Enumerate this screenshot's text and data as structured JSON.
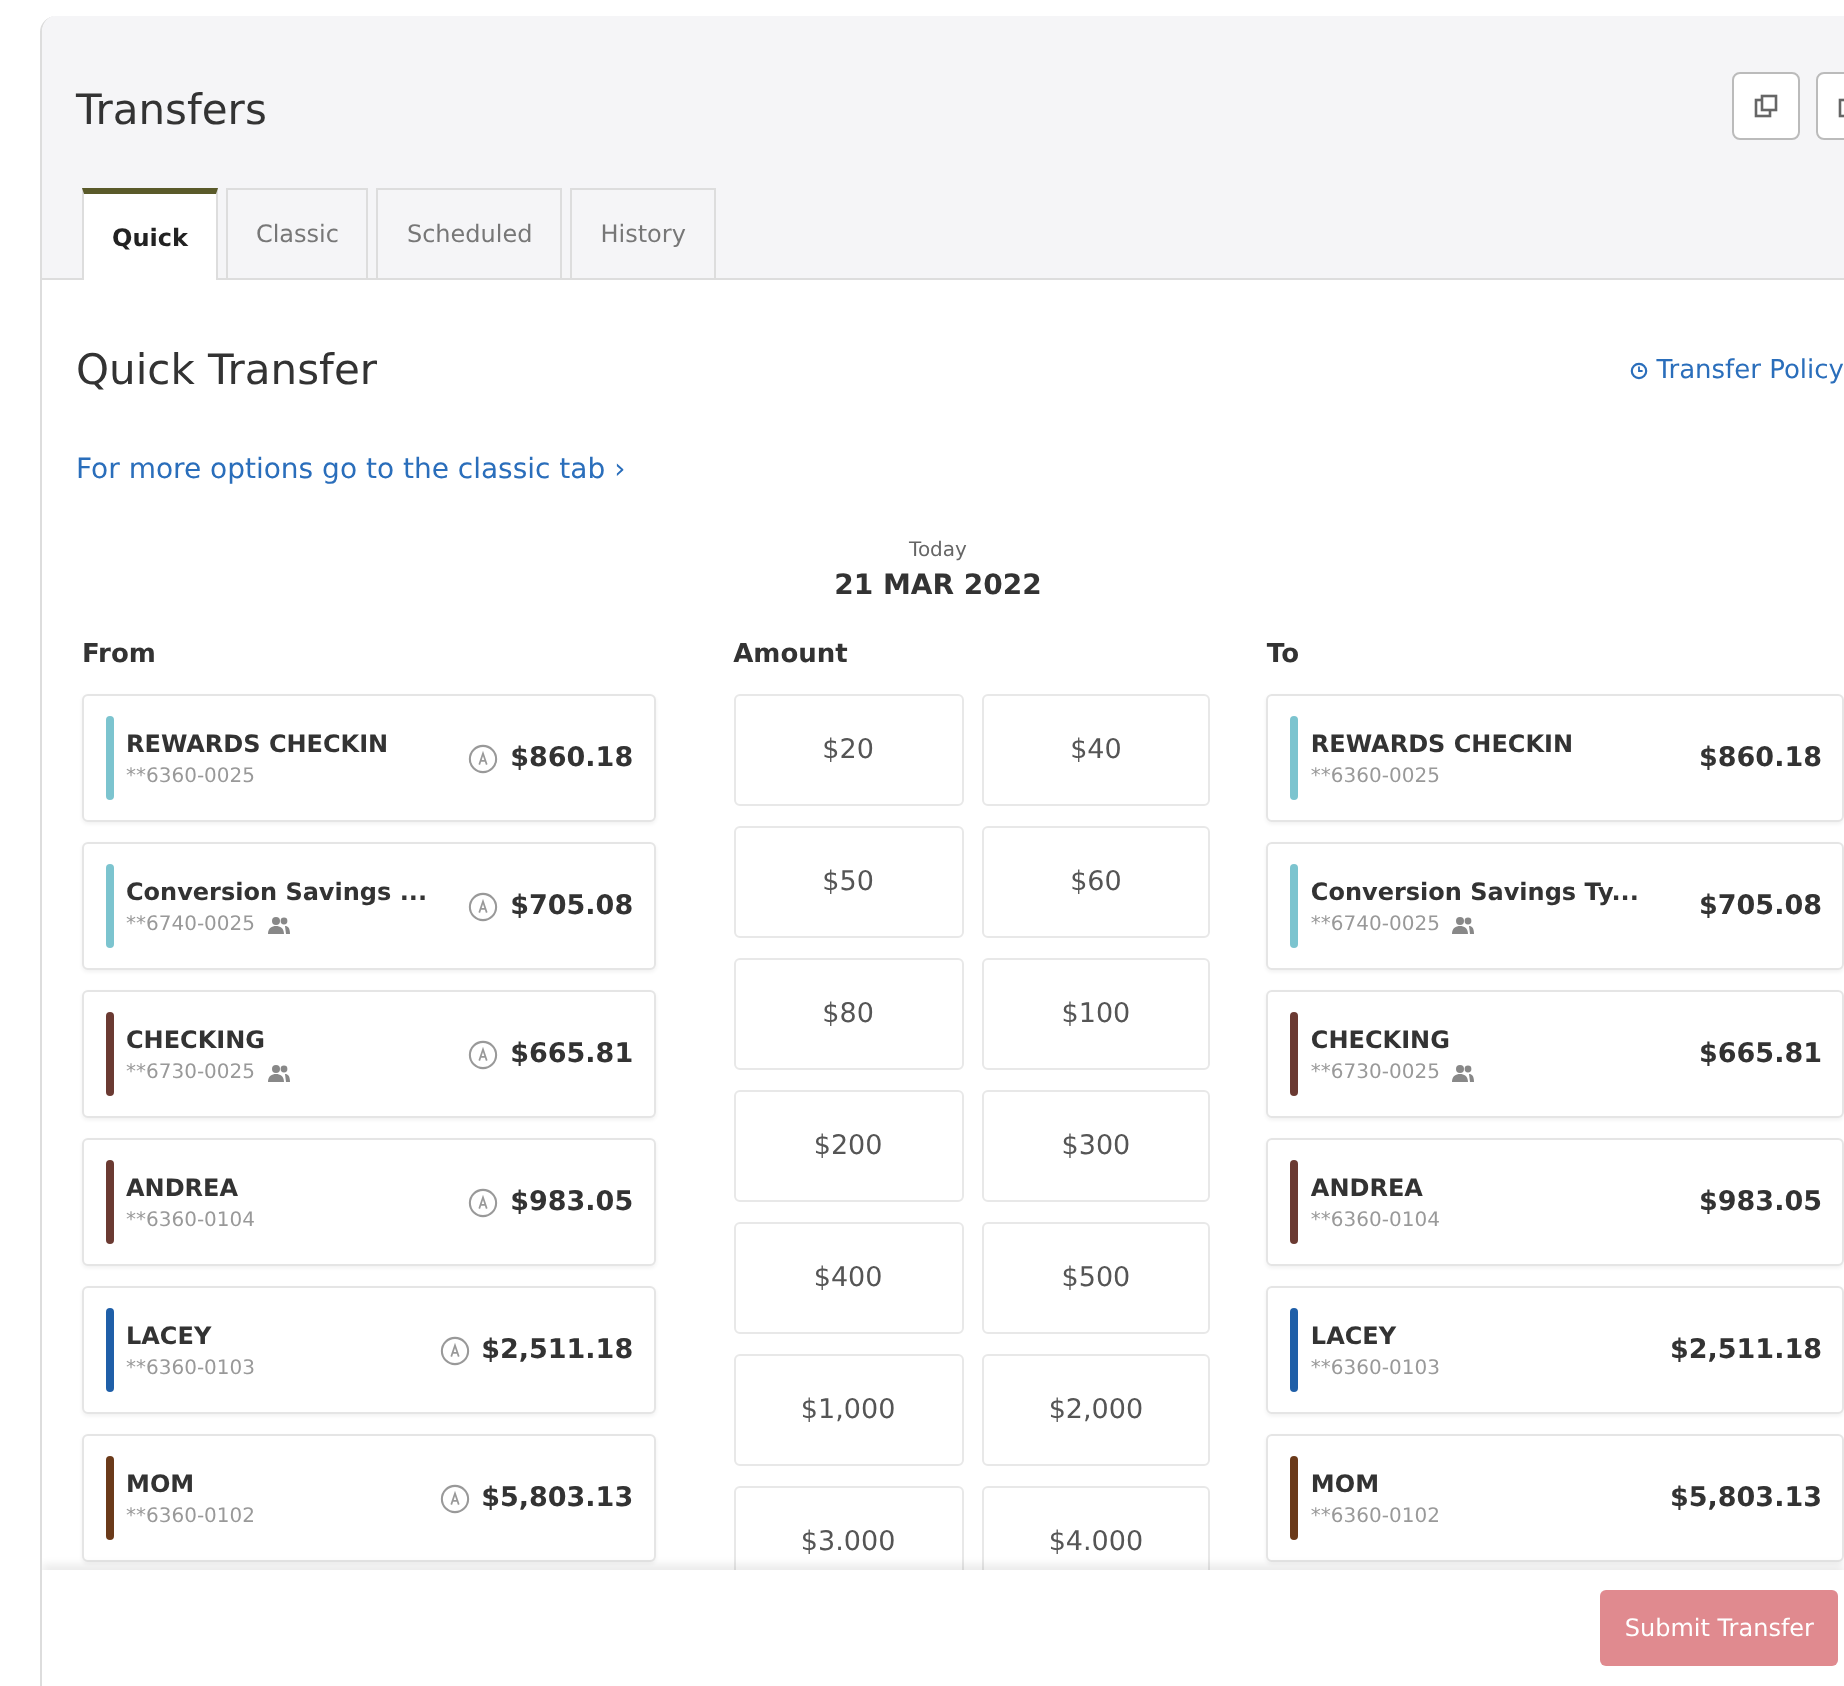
{
  "title": "Transfers",
  "tabs": [
    {
      "label": "Quick",
      "selected": true
    },
    {
      "label": "Classic",
      "selected": false
    },
    {
      "label": "Scheduled",
      "selected": false
    },
    {
      "label": "History",
      "selected": false
    }
  ],
  "section": {
    "title": "Quick Transfer",
    "policy_link": "Transfer Policy",
    "classic_link": "For more options go to the classic tab ›"
  },
  "date": {
    "label": "Today",
    "value": "21 MAR 2022"
  },
  "from": {
    "heading": "From",
    "accounts": [
      {
        "name": "REWARDS CHECKIN",
        "number": "**6360-0025",
        "shared": false,
        "color": "#7cc4cf",
        "balance": "$860.18"
      },
      {
        "name": "Conversion Savings ...",
        "number": "**6740-0025",
        "shared": true,
        "color": "#7cc4cf",
        "balance": "$705.08"
      },
      {
        "name": "CHECKING",
        "number": "**6730-0025",
        "shared": true,
        "color": "#6b3a32",
        "balance": "$665.81"
      },
      {
        "name": "ANDREA",
        "number": "**6360-0104",
        "shared": false,
        "color": "#6b3a32",
        "balance": "$983.05"
      },
      {
        "name": "LACEY",
        "number": "**6360-0103",
        "shared": false,
        "color": "#1f5fa8",
        "balance": "$2,511.18"
      },
      {
        "name": "MOM",
        "number": "**6360-0102",
        "shared": false,
        "color": "#6b3a1a",
        "balance": "$5,803.13"
      }
    ]
  },
  "amount": {
    "heading": "Amount",
    "options": [
      "$20",
      "$40",
      "$50",
      "$60",
      "$80",
      "$100",
      "$200",
      "$300",
      "$400",
      "$500",
      "$1,000",
      "$2,000",
      "$3.000",
      "$4.000"
    ]
  },
  "to": {
    "heading": "To",
    "accounts": [
      {
        "name": "REWARDS CHECKIN",
        "number": "**6360-0025",
        "shared": false,
        "color": "#7cc4cf",
        "balance": "$860.18"
      },
      {
        "name": "Conversion Savings Ty...",
        "number": "**6740-0025",
        "shared": true,
        "color": "#7cc4cf",
        "balance": "$705.08"
      },
      {
        "name": "CHECKING",
        "number": "**6730-0025",
        "shared": true,
        "color": "#6b3a32",
        "balance": "$665.81"
      },
      {
        "name": "ANDREA",
        "number": "**6360-0104",
        "shared": false,
        "color": "#6b3a32",
        "balance": "$983.05"
      },
      {
        "name": "LACEY",
        "number": "**6360-0103",
        "shared": false,
        "color": "#1f5fa8",
        "balance": "$2,511.18"
      },
      {
        "name": "MOM",
        "number": "**6360-0102",
        "shared": false,
        "color": "#6b3a1a",
        "balance": "$5,803.13"
      }
    ]
  },
  "submit": {
    "label": "Submit Transfer",
    "disabled": true
  }
}
